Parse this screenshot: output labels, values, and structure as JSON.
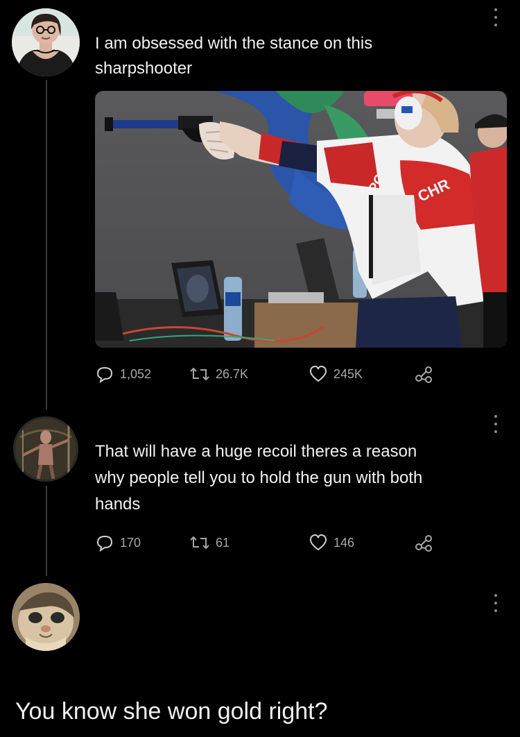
{
  "post1": {
    "text_line1": "I am obsessed with the stance on this",
    "text_line2": "sharpshooter",
    "image_text": {
      "jacket_left": "РОССИЯ",
      "jacket_right": "CHR"
    },
    "actions": {
      "replies": "1,052",
      "retweets": "26.7K",
      "likes": "245K"
    }
  },
  "post2": {
    "text_line1": "That will have a huge recoil theres a reason",
    "text_line2": "why people tell you to hold the gun with both",
    "text_line3": "hands",
    "actions": {
      "replies": "170",
      "retweets": "61",
      "likes": "146"
    }
  },
  "post3": {
    "caption": "You know she won gold right?"
  },
  "icons": [
    "reply-icon",
    "retweet-icon",
    "like-icon",
    "share-icon",
    "more-options-icon"
  ],
  "colors": {
    "background": "#000000",
    "text": "#f2f2f2",
    "muted": "#a8a8a8",
    "thread_line": "#3a3a3a",
    "jacket_red": "#d32a2a"
  }
}
